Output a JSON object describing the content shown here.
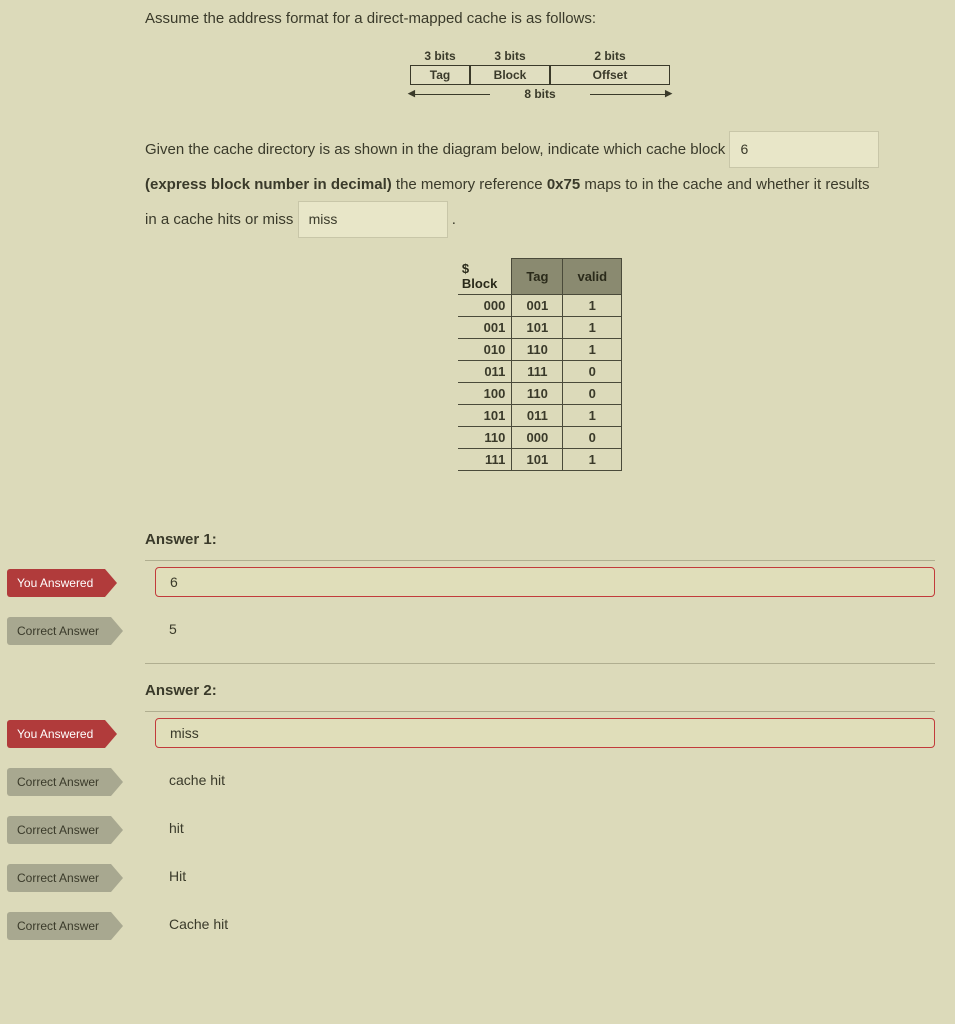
{
  "intro": "Assume the address format for a direct-mapped cache is as follows:",
  "addr_format": {
    "bits": {
      "tag": "3 bits",
      "block": "3 bits",
      "offset": "2 bits"
    },
    "labels": {
      "tag": "Tag",
      "block": "Block",
      "offset": "Offset"
    },
    "total": "8 bits"
  },
  "para": {
    "p1a": "Given  the cache directory is as shown in the diagram below, indicate which cache block",
    "blank1": "6",
    "p2a": "(express block number in decimal)",
    "p2b": " the  memory reference ",
    "memref": "0x75",
    "p2c": " maps to in the cache and whether it results",
    "p3a": "in a cache hits or miss",
    "blank2": "miss",
    "period": "."
  },
  "cache_table": {
    "headers": {
      "sblock": "$\nBlock",
      "tag": "Tag",
      "valid": "valid"
    },
    "rows": [
      {
        "block": "000",
        "tag": "001",
        "valid": "1"
      },
      {
        "block": "001",
        "tag": "101",
        "valid": "1"
      },
      {
        "block": "010",
        "tag": "110",
        "valid": "1"
      },
      {
        "block": "011",
        "tag": "111",
        "valid": "0"
      },
      {
        "block": "100",
        "tag": "110",
        "valid": "0"
      },
      {
        "block": "101",
        "tag": "011",
        "valid": "1"
      },
      {
        "block": "110",
        "tag": "000",
        "valid": "0"
      },
      {
        "block": "111",
        "tag": "101",
        "valid": "1"
      }
    ]
  },
  "answers": {
    "a1_label": "Answer 1:",
    "a2_label": "Answer 2:",
    "you_answered": "You Answered",
    "correct_answer": "Correct Answer",
    "a1_user": "6",
    "a1_correct": "5",
    "a2_user": "miss",
    "a2_correct": [
      "cache hit",
      "hit",
      "Hit",
      "Cache hit"
    ]
  }
}
